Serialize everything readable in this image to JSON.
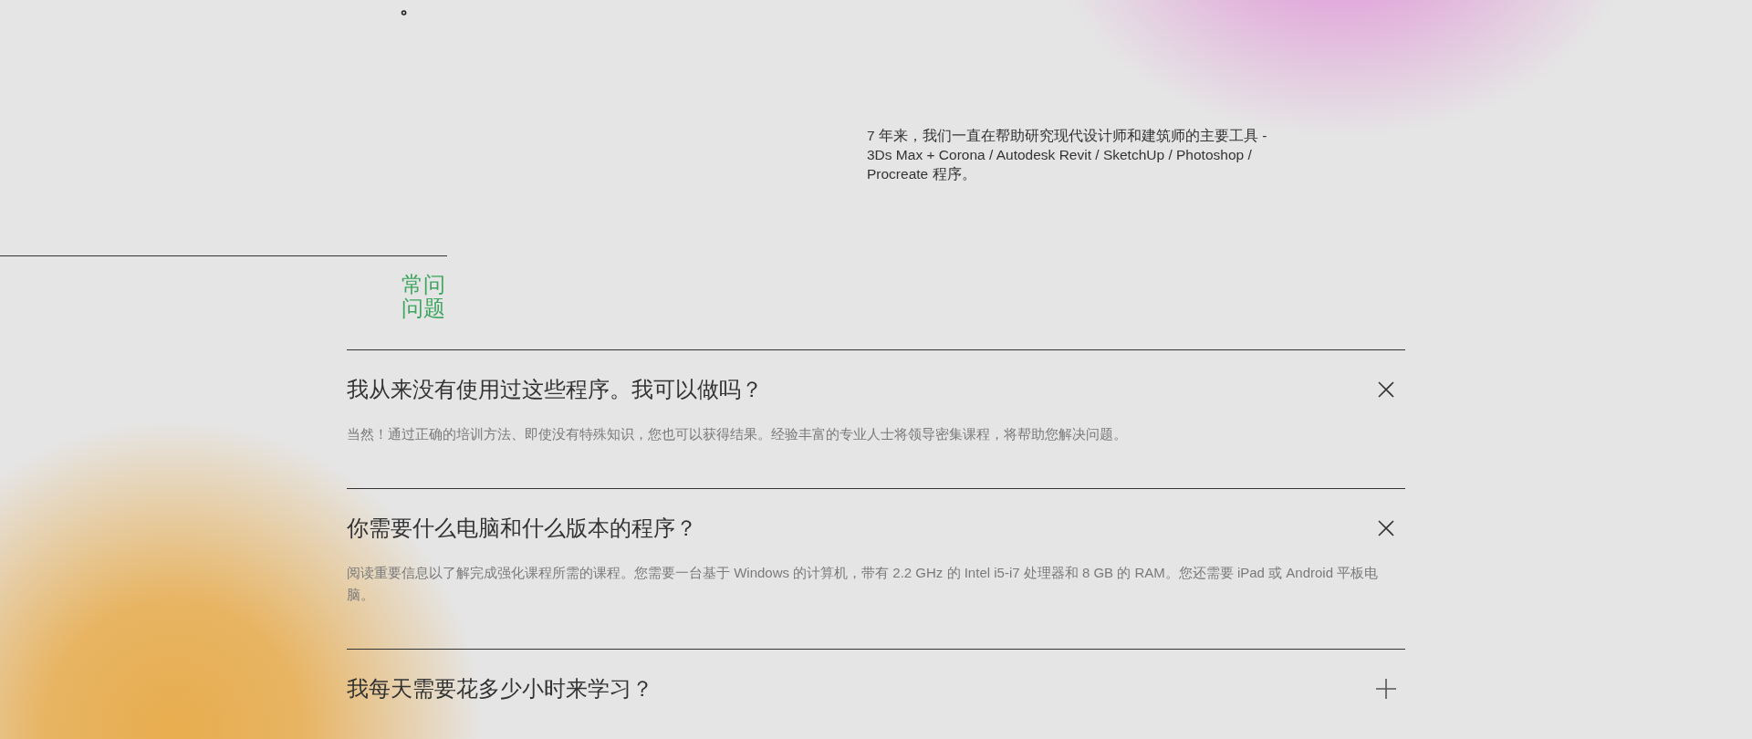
{
  "top_mark": "。",
  "intro": "7 年来，我们一直在帮助研究现代设计师和建筑师的主要工具 - 3Ds Max + Corona / Autodesk Revit / SketchUp / Photoshop / Procreate 程序。",
  "faq": {
    "title": "常问问题",
    "items": [
      {
        "question": "我从来没有使用过这些程序。我可以做吗？",
        "expanded": true,
        "answer": "当然！通过正确的培训方法、即使没有特殊知识，您也可以获得结果。经验丰富的专业人士将领导密集课程，将帮助您解决问题。"
      },
      {
        "question": "你需要什么电脑和什么版本的程序？",
        "expanded": true,
        "answer": "阅读重要信息以了解完成强化课程所需的课程。您需要一台基于 Windows 的计算机，带有 2.2 GHz 的 Intel i5-i7 处理器和 8 GB 的 RAM。您还需要 iPad 或 Android 平板电脑。"
      },
      {
        "question": "我每天需要花多少小时来学习？",
        "expanded": false
      }
    ]
  }
}
